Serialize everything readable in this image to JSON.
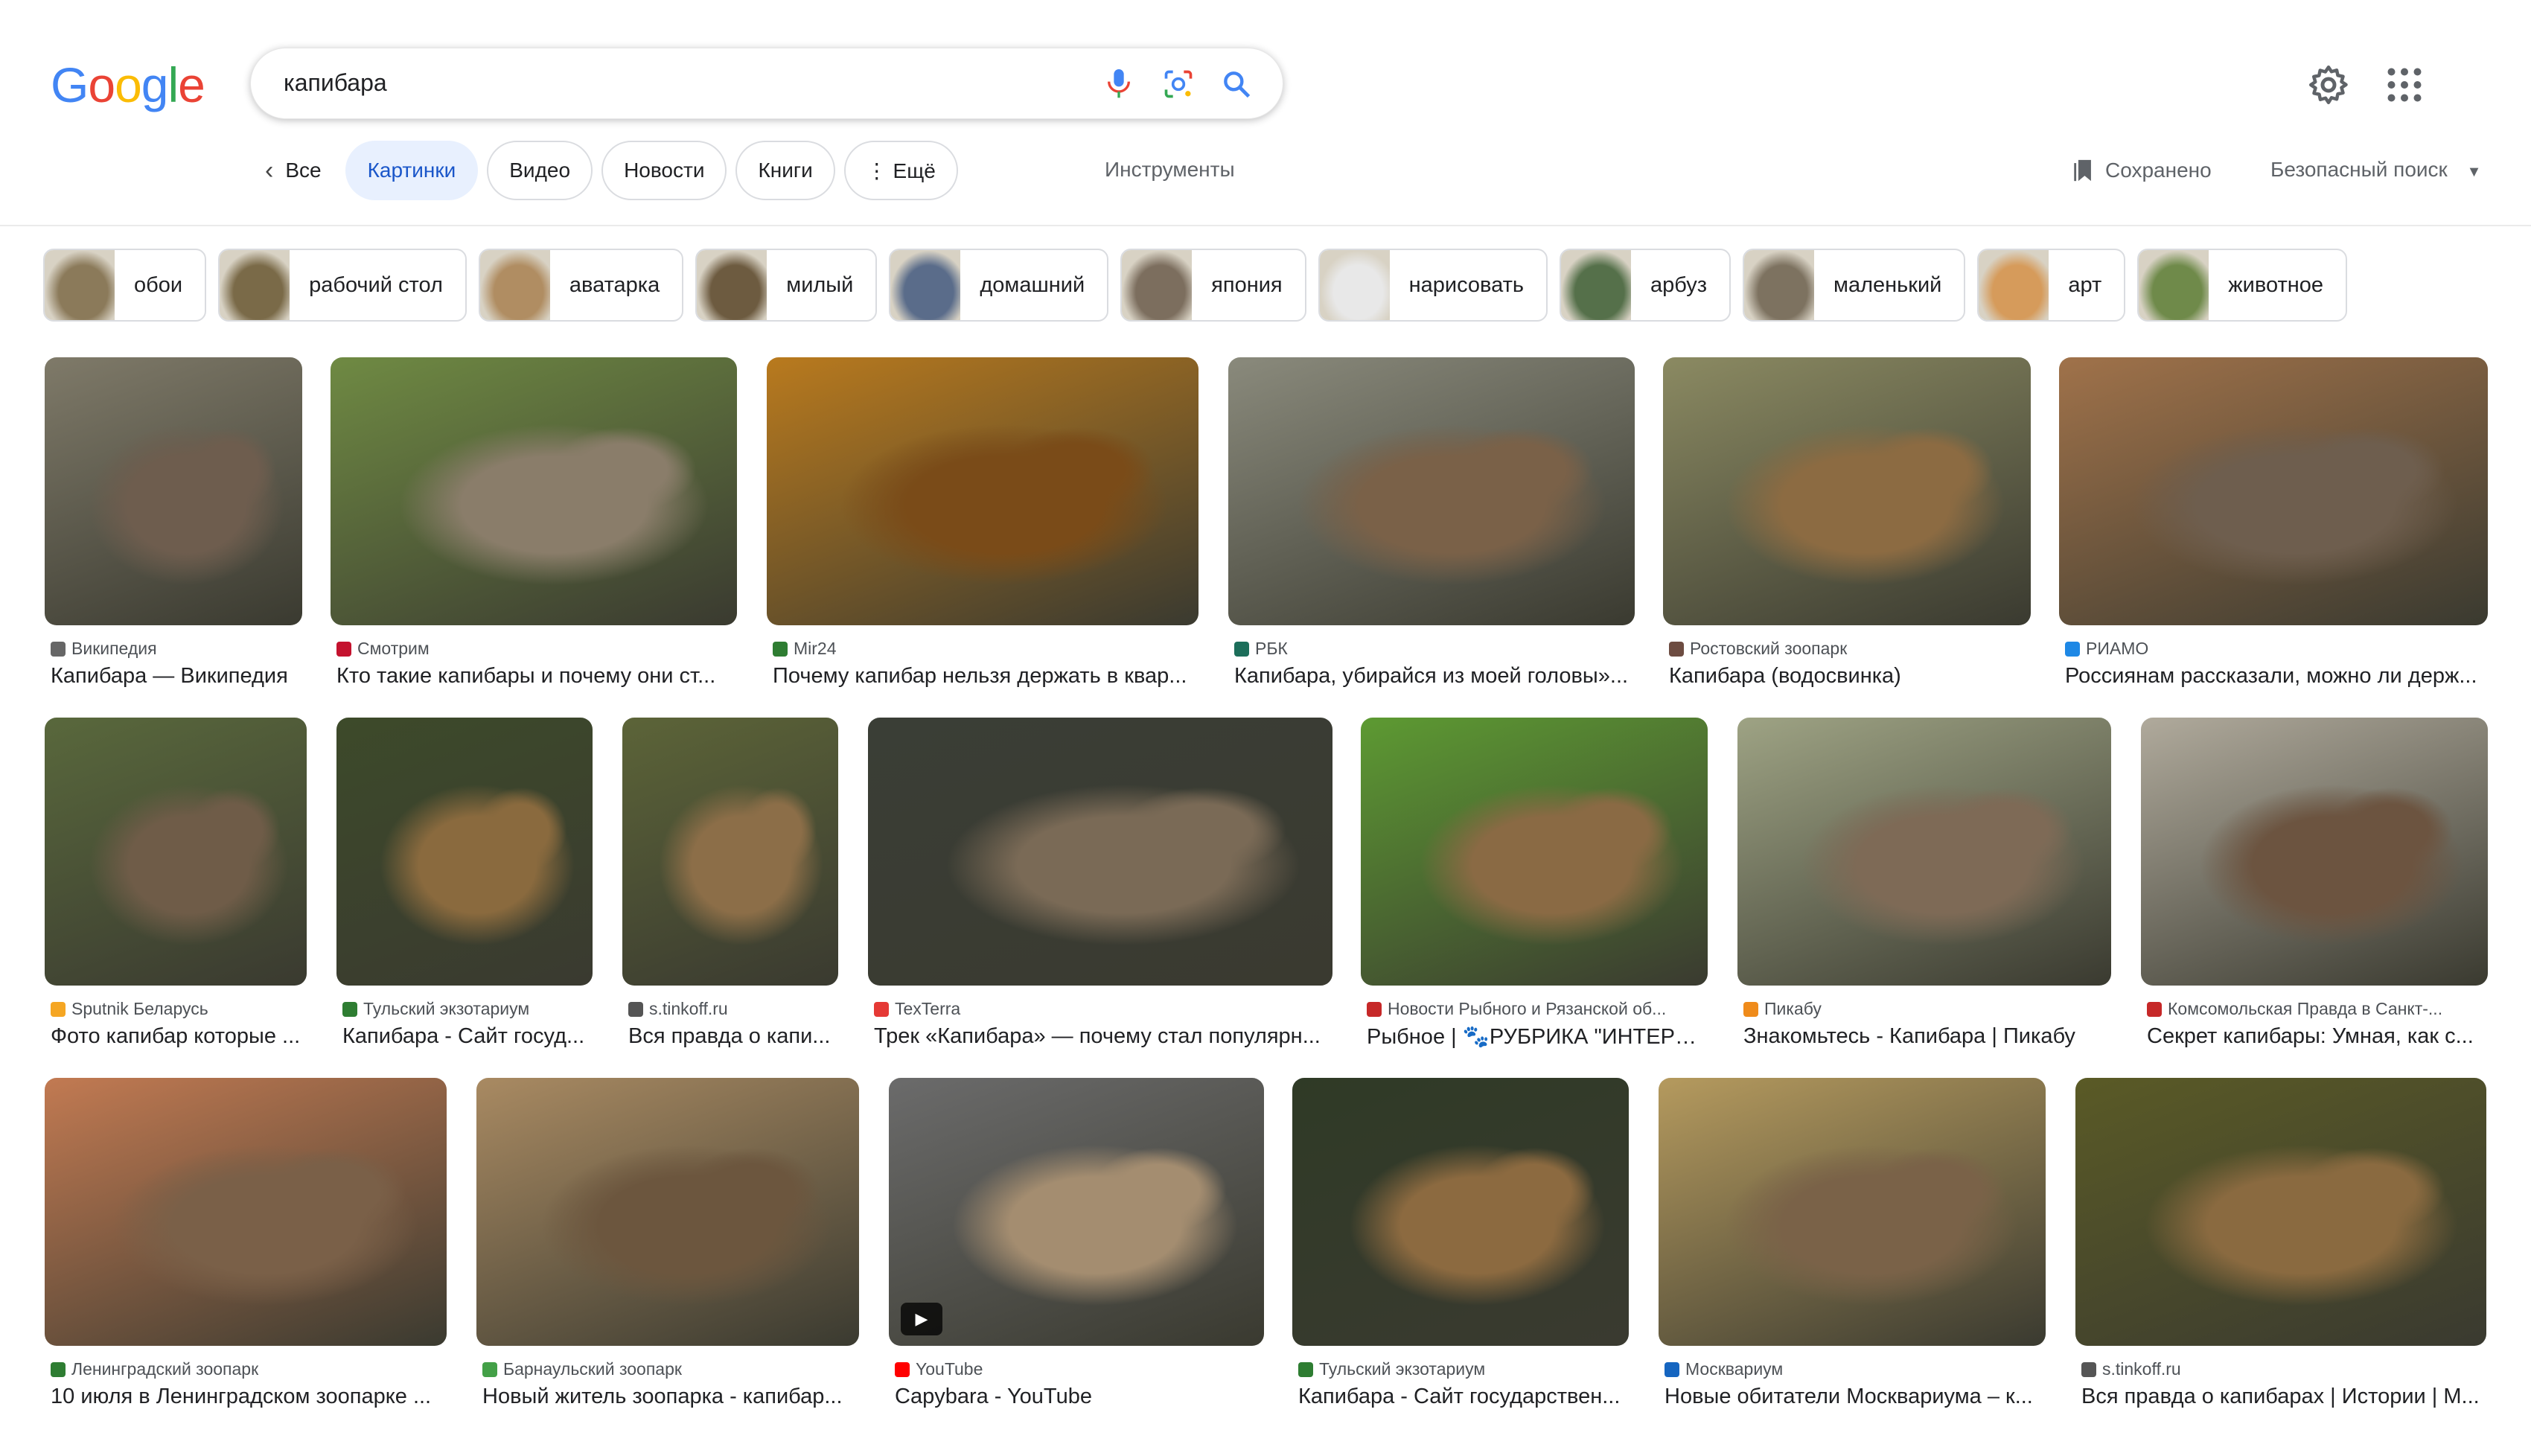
{
  "logo": {
    "letters": [
      "G",
      "o",
      "o",
      "g",
      "l",
      "e"
    ],
    "colors": [
      "#4285f4",
      "#ea4335",
      "#fbbc05",
      "#4285f4",
      "#34a853",
      "#ea4335"
    ]
  },
  "search": {
    "query": "капибара"
  },
  "tabs": [
    {
      "label": "Все",
      "active": false
    },
    {
      "label": "Картинки",
      "active": true
    },
    {
      "label": "Видео",
      "active": false
    },
    {
      "label": "Новости",
      "active": false
    },
    {
      "label": "Книги",
      "active": false
    },
    {
      "label": "⋮ Ещё",
      "active": false
    }
  ],
  "tools_label": "Инструменты",
  "saved_label": "Сохранено",
  "safesearch_label": "Безопасный поиск",
  "chips": [
    {
      "label": "обои",
      "color": "#8b7a5a"
    },
    {
      "label": "рабочий стол",
      "color": "#7a6a48"
    },
    {
      "label": "аватарка",
      "color": "#b08d62"
    },
    {
      "label": "милый",
      "color": "#6d5b40"
    },
    {
      "label": "домашний",
      "color": "#5a6c8a"
    },
    {
      "label": "япония",
      "color": "#7c6e5e"
    },
    {
      "label": "нарисовать",
      "color": "#e8e8e8"
    },
    {
      "label": "арбуз",
      "color": "#55704a"
    },
    {
      "label": "маленький",
      "color": "#7d7260"
    },
    {
      "label": "арт",
      "color": "#d69b5b"
    },
    {
      "label": "животное",
      "color": "#6f8a4a"
    }
  ],
  "rows": [
    [
      {
        "source": "Википедия",
        "title": "Капибара — Википедия",
        "fav": "#666666",
        "bg": "#7f7a69",
        "fg": "#6e5d4e"
      },
      {
        "source": "Смотрим",
        "title": "Кто такие капибары и почему они ст...",
        "fav": "#c4122e",
        "bg": "#6f8a43",
        "fg": "#8a7d6a"
      },
      {
        "source": "Mir24",
        "title": "Почему капибар нельзя держать в квар...",
        "fav": "#2e7d32",
        "bg": "#b97a1e",
        "fg": "#7a4b18"
      },
      {
        "source": "РБК",
        "title": "Капибара, убирайся из моей головы»...",
        "fav": "#1c6e5a",
        "bg": "#8a8a7c",
        "fg": "#7a6148"
      },
      {
        "source": "Ростовский зоопарк",
        "title": "Капибара (водосвинка)",
        "fav": "#6d4c41",
        "bg": "#8b8a62",
        "fg": "#8c6b42"
      },
      {
        "source": "РИАМО",
        "title": "Россиянам рассказали, можно ли держ...",
        "fav": "#1e88e5",
        "bg": "#a0724a",
        "fg": "#6e5e4e"
      }
    ],
    [
      {
        "source": "Sputnik Беларусь",
        "title": "Фото капибар которые ...",
        "fav": "#f5a623",
        "bg": "#59683c",
        "fg": "#6f5c48"
      },
      {
        "source": "Тульский экзотариум",
        "title": "Капибара - Сайт госуд...",
        "fav": "#2e7d32",
        "bg": "#3d4a2a",
        "fg": "#8a6a3e"
      },
      {
        "source": "s.tinkoff.ru",
        "title": "Вся правда о капи...",
        "fav": "#555555",
        "bg": "#5c6438",
        "fg": "#8c6e48"
      },
      {
        "source": "TexTerra",
        "title": "Трек «Капибара» — почему стал популярн...",
        "fav": "#e53935",
        "bg": "#3a3e36",
        "fg": "#7a6a56"
      },
      {
        "source": "Новости Рыбного и Рязанской об...",
        "title": "Рыбное | 🐾РУБРИКА \"ИНТЕРЕС...",
        "fav": "#c62828",
        "bg": "#5d9a32",
        "fg": "#8a6a44"
      },
      {
        "source": "Пикабу",
        "title": "Знакомьтесь - Капибара | Пикабу",
        "fav": "#ef8b1b",
        "bg": "#9ea384",
        "fg": "#7e6a56"
      },
      {
        "source": "Комсомольская Правда в Санкт-...",
        "title": "Секрет капибары: Умная, как с...",
        "fav": "#c62828",
        "bg": "#b0aa9c",
        "fg": "#6c5440"
      }
    ],
    [
      {
        "source": "Ленинградский зоопарк",
        "title": "10 июля в Ленинградском зоопарке ...",
        "fav": "#2e7d32",
        "bg": "#c27a52",
        "fg": "#7a6048"
      },
      {
        "source": "Барнаульский зоопарк",
        "title": "Новый житель зоопарка - капибар...",
        "fav": "#43a047",
        "bg": "#a98a62",
        "fg": "#6c563e"
      },
      {
        "source": "YouTube",
        "title": "Capybara - YouTube",
        "fav": "#ff0000",
        "bg": "#6b6b6b",
        "fg": "#a48d70",
        "video": true
      },
      {
        "source": "Тульский экзотариум",
        "title": "Капибара - Сайт государствен...",
        "fav": "#2e7d32",
        "bg": "#2f3a26",
        "fg": "#8c6a40"
      },
      {
        "source": "Москвариум",
        "title": "Новые обитатели Москвариума – к...",
        "fav": "#1565c0",
        "bg": "#b59a5e",
        "fg": "#7a6248"
      },
      {
        "source": "s.tinkoff.ru",
        "title": "Вся правда о капибарах | Истории | М...",
        "fav": "#555555",
        "bg": "#5a5a26",
        "fg": "#8a6a40"
      }
    ]
  ]
}
